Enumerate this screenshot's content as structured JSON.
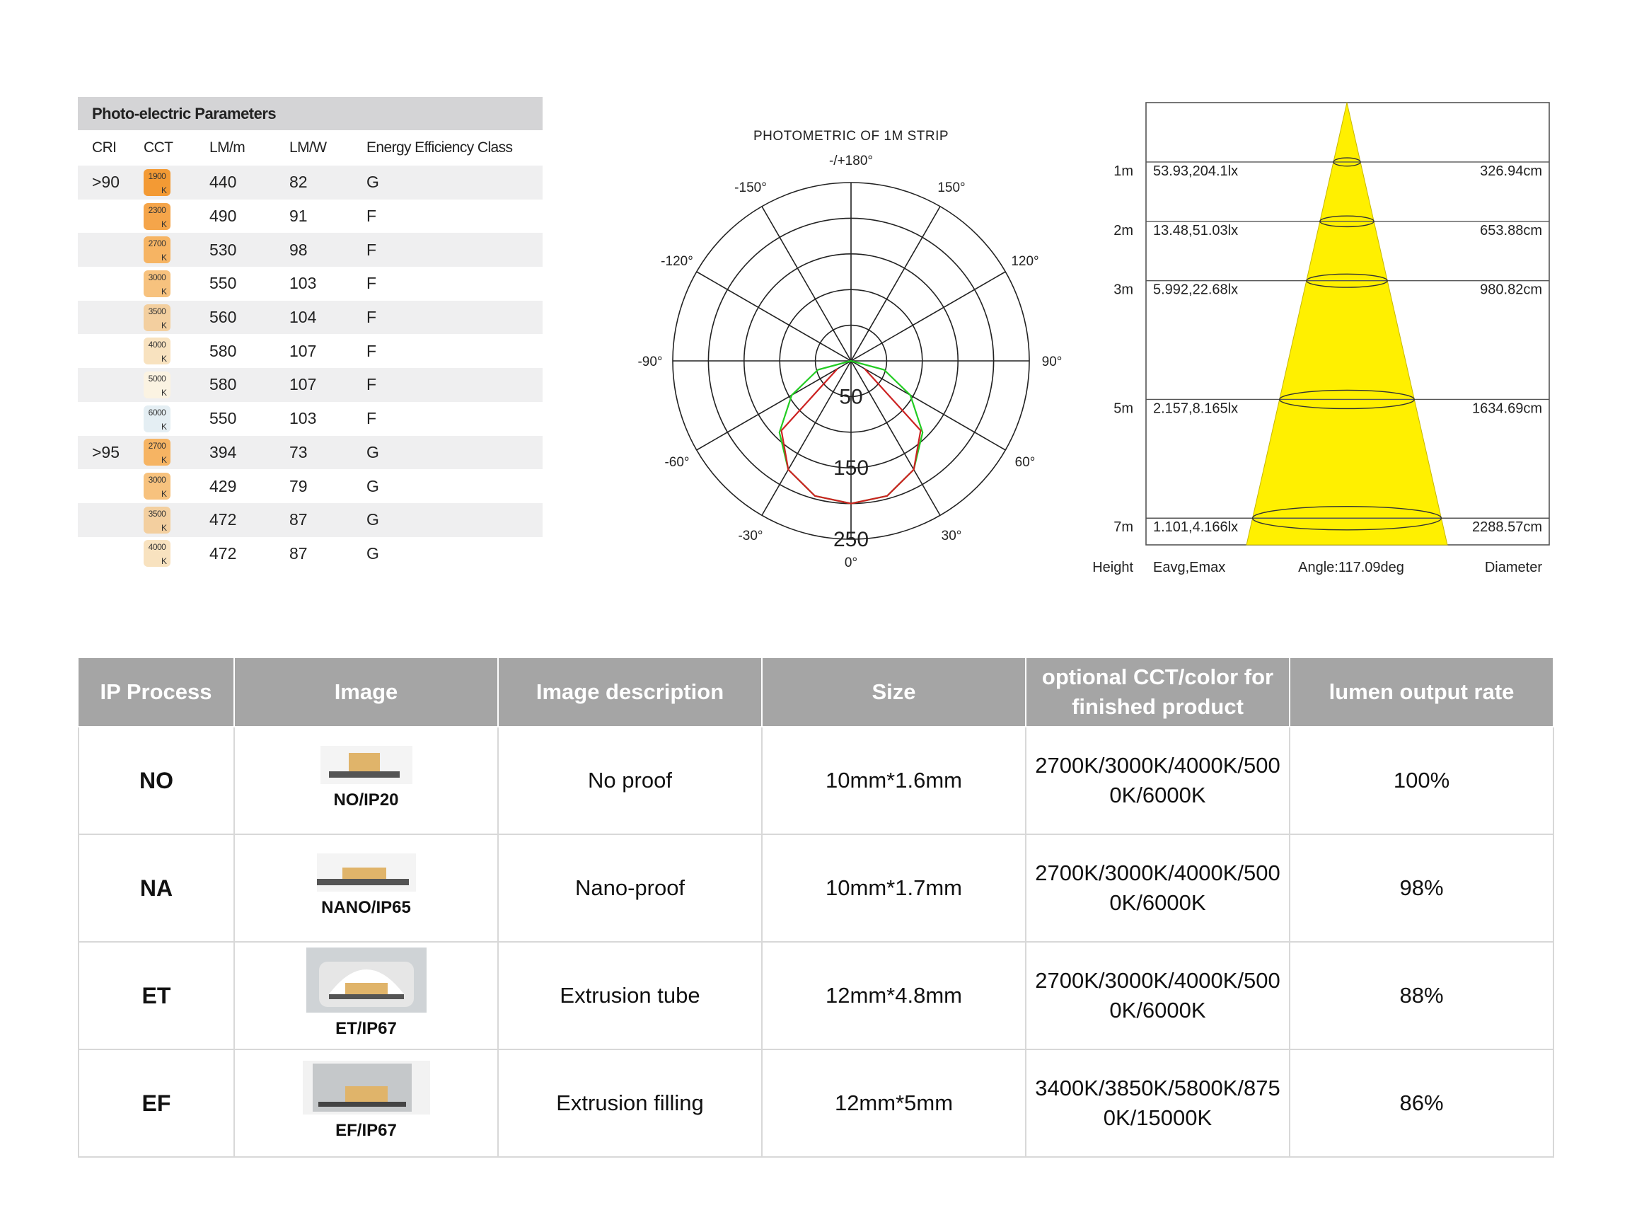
{
  "photo_electric": {
    "title": "Photo-electric Parameters",
    "headers": [
      "CRI",
      "CCT",
      "LM/m",
      "LM/W",
      "Energy Efficiency Class"
    ],
    "rows": [
      {
        "cri": ">90",
        "cct": "1900",
        "cct_unit": "K",
        "color": "#f39a34",
        "lm_m": "440",
        "lm_w": "82",
        "eec": "G"
      },
      {
        "cri": "",
        "cct": "2300",
        "cct_unit": "K",
        "color": "#f5a54a",
        "lm_m": "490",
        "lm_w": "91",
        "eec": "F"
      },
      {
        "cri": "",
        "cct": "2700",
        "cct_unit": "K",
        "color": "#f6b463",
        "lm_m": "530",
        "lm_w": "98",
        "eec": "F"
      },
      {
        "cri": "",
        "cct": "3000",
        "cct_unit": "K",
        "color": "#f7c27e",
        "lm_m": "550",
        "lm_w": "103",
        "eec": "F"
      },
      {
        "cri": "",
        "cct": "3500",
        "cct_unit": "K",
        "color": "#f3cf9f",
        "lm_m": "560",
        "lm_w": "104",
        "eec": "F"
      },
      {
        "cri": "",
        "cct": "4000",
        "cct_unit": "K",
        "color": "#f8e2bf",
        "lm_m": "580",
        "lm_w": "107",
        "eec": "F"
      },
      {
        "cri": "",
        "cct": "5000",
        "cct_unit": "K",
        "color": "#fbf3e2",
        "lm_m": "580",
        "lm_w": "107",
        "eec": "F"
      },
      {
        "cri": "",
        "cct": "6000",
        "cct_unit": "K",
        "color": "#e4eef3",
        "lm_m": "550",
        "lm_w": "103",
        "eec": "F"
      },
      {
        "cri": ">95",
        "cct": "2700",
        "cct_unit": "K",
        "color": "#f6b463",
        "lm_m": "394",
        "lm_w": "73",
        "eec": "G"
      },
      {
        "cri": "",
        "cct": "3000",
        "cct_unit": "K",
        "color": "#f7c27e",
        "lm_m": "429",
        "lm_w": "79",
        "eec": "G"
      },
      {
        "cri": "",
        "cct": "3500",
        "cct_unit": "K",
        "color": "#f3cf9f",
        "lm_m": "472",
        "lm_w": "87",
        "eec": "G"
      },
      {
        "cri": "",
        "cct": "4000",
        "cct_unit": "K",
        "color": "#f8e2bf",
        "lm_m": "472",
        "lm_w": "87",
        "eec": "G"
      }
    ]
  },
  "chart_data": [
    {
      "type": "polar",
      "title": "PHOTOMETRIC OF 1M  STRIP",
      "angle_labels": [
        {
          "deg": 0,
          "text": "0°"
        },
        {
          "deg": 30,
          "text": "30°"
        },
        {
          "deg": 60,
          "text": "60°"
        },
        {
          "deg": 90,
          "text": "90°"
        },
        {
          "deg": 120,
          "text": "120°"
        },
        {
          "deg": 150,
          "text": "150°"
        },
        {
          "deg": 180,
          "text": "-/+180°"
        },
        {
          "deg": -150,
          "text": "-150°"
        },
        {
          "deg": -120,
          "text": "-120°"
        },
        {
          "deg": -90,
          "text": "-90°"
        },
        {
          "deg": -60,
          "text": "-60°"
        },
        {
          "deg": -30,
          "text": "-30°"
        }
      ],
      "radial_ticks": [
        "50",
        "150",
        "250"
      ],
      "rmax": 250,
      "series": [
        {
          "color": "#22cc22",
          "angles": [
            -90,
            -75,
            -60,
            -45,
            -30,
            -15,
            0,
            15,
            30,
            45,
            60,
            75,
            90
          ],
          "values": [
            0,
            48,
            96,
            142,
            176,
            196,
            200,
            196,
            176,
            142,
            96,
            48,
            0
          ]
        },
        {
          "color": "#cc2222",
          "angles": [
            -60,
            -45,
            -30,
            -15,
            0,
            15,
            30,
            45,
            60
          ],
          "values": [
            22,
            138,
            176,
            196,
            200,
            196,
            176,
            138,
            22
          ]
        }
      ]
    },
    {
      "type": "beam-cone",
      "columns": [
        "Height",
        "Eavg,Emax",
        "Angle:117.09deg",
        "Diameter"
      ],
      "beam_color": "#fff000",
      "levels": [
        {
          "height": "1m",
          "h": 1,
          "eavg_emax": "53.93,204.1lx",
          "diameter": "326.94cm"
        },
        {
          "height": "2m",
          "h": 2,
          "eavg_emax": "13.48,51.03lx",
          "diameter": "653.88cm"
        },
        {
          "height": "3m",
          "h": 3,
          "eavg_emax": "5.992,22.68lx",
          "diameter": "980.82cm"
        },
        {
          "height": "5m",
          "h": 5,
          "eavg_emax": "2.157,8.165lx",
          "diameter": "1634.69cm"
        },
        {
          "height": "7m",
          "h": 7,
          "eavg_emax": "1.101,4.166lx",
          "diameter": "2288.57cm"
        }
      ]
    }
  ],
  "ip_table": {
    "headers": [
      "IP Process",
      "Image",
      "Image description",
      "Size",
      "optional CCT/color for finished product",
      "lumen output rate"
    ],
    "rows": [
      {
        "process": "NO",
        "image_caption": "NO/IP20",
        "image_icon": "bare-strip-icon",
        "description": "No proof",
        "size": "10mm*1.6mm",
        "cct": "2700K/3000K/4000K/5000K/6000K",
        "rate": "100%"
      },
      {
        "process": "NA",
        "image_caption": "NANO/IP65",
        "image_icon": "nano-coated-strip-icon",
        "description": "Nano-proof",
        "size": "10mm*1.7mm",
        "cct": "2700K/3000K/4000K/5000K/6000K",
        "rate": "98%"
      },
      {
        "process": "ET",
        "image_caption": "ET/IP67",
        "image_icon": "extrusion-tube-strip-icon",
        "description": "Extrusion tube",
        "size": "12mm*4.8mm",
        "cct": "2700K/3000K/4000K/5000K/6000K",
        "rate": "88%"
      },
      {
        "process": "EF",
        "image_caption": "EF/IP67",
        "image_icon": "extrusion-filled-strip-icon",
        "description": "Extrusion filling",
        "size": "12mm*5mm",
        "cct": "3400K/3850K/5800K/8750K/15000K",
        "rate": "86%"
      }
    ]
  }
}
